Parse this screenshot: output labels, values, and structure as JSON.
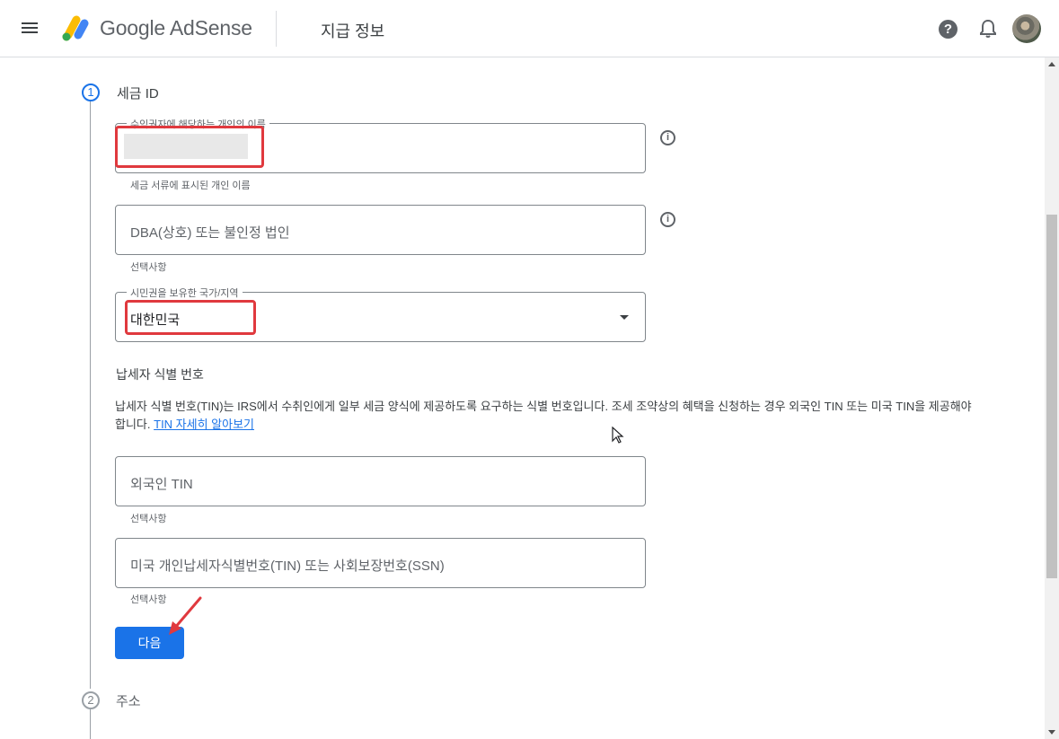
{
  "header": {
    "app_name": "Google AdSense",
    "page_title": "지급 정보",
    "help_glyph": "?",
    "icons": [
      "menu-icon",
      "adsense-logo",
      "help-icon",
      "bell-icon",
      "avatar"
    ]
  },
  "stepper": {
    "steps": [
      {
        "number": "1",
        "title": "세금 ID",
        "active": true
      },
      {
        "number": "2",
        "title": "주소",
        "active": false
      }
    ]
  },
  "form": {
    "name_field": {
      "label": "수익권자에 해당하는 개인의 이름",
      "value": "",
      "hint": "세금 서류에 표시된 개인 이름"
    },
    "dba_field": {
      "placeholder": "DBA(상호) 또는 불인정 법인",
      "hint": "선택사항"
    },
    "country_field": {
      "label": "시민권을 보유한 국가/지역",
      "value": "대한민국"
    },
    "tin_section": {
      "heading": "납세자 식별 번호",
      "description": "납세자 식별 번호(TIN)는 IRS에서 수취인에게 일부 세금 양식에 제공하도록 요구하는 식별 번호입니다. 조세 조약상의 혜택을 신청하는 경우 외국인 TIN 또는 미국 TIN을 제공해야 합니다.",
      "link": "TIN 자세히 알아보기"
    },
    "foreign_tin_field": {
      "placeholder": "외국인 TIN",
      "hint": "선택사항"
    },
    "us_tin_field": {
      "placeholder": "미국 개인납세자식별번호(TIN) 또는 사회보장번호(SSN)",
      "hint": "선택사항"
    },
    "next_button": "다음"
  },
  "info_glyph": "i",
  "colors": {
    "accent": "#1a73e8",
    "annotation_red": "#e0393e",
    "border": "#80868b"
  }
}
